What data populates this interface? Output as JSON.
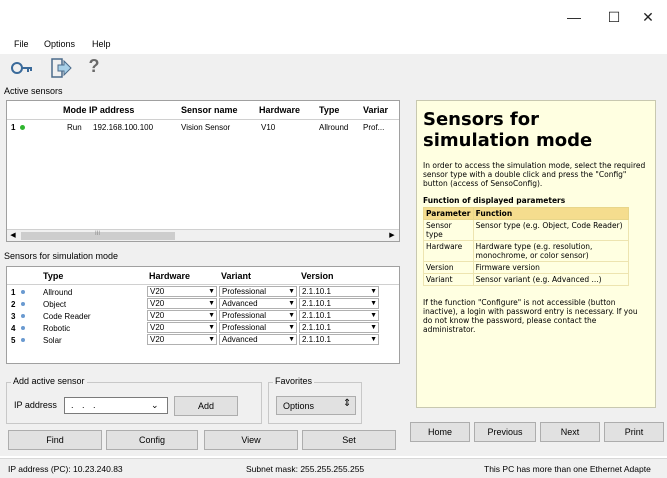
{
  "window": {
    "minimize": "—",
    "maximize": "☐",
    "close": "✕"
  },
  "menu": [
    "File",
    "Options",
    "Help"
  ],
  "toolbar": {
    "icons": [
      "key-icon",
      "export-icon",
      "help-icon"
    ],
    "help_glyph": "?"
  },
  "active_sensors": {
    "label": "Active sensors",
    "headers": [
      "Mode",
      "IP address",
      "Sensor name",
      "Hardware",
      "Type",
      "Variar"
    ],
    "rows": [
      {
        "num": "1",
        "status": "green",
        "mode": "Run",
        "ip": "192.168.100.100",
        "name": "Vision Sensor",
        "hardware": "V10",
        "type": "Allround",
        "variant": "Prof..."
      }
    ],
    "scroll_mark": "III"
  },
  "sim_sensors": {
    "label": "Sensors for simulation mode",
    "headers": [
      "Type",
      "Hardware",
      "Variant",
      "Version"
    ],
    "rows": [
      {
        "num": "1",
        "type": "Allround",
        "hardware": "V20",
        "variant": "Professional",
        "version": "2.1.10.1"
      },
      {
        "num": "2",
        "type": "Object",
        "hardware": "V20",
        "variant": "Advanced",
        "version": "2.1.10.1"
      },
      {
        "num": "3",
        "type": "Code Reader",
        "hardware": "V20",
        "variant": "Professional",
        "version": "2.1.10.1"
      },
      {
        "num": "4",
        "type": "Robotic",
        "hardware": "V20",
        "variant": "Professional",
        "version": "2.1.10.1"
      },
      {
        "num": "5",
        "type": "Solar",
        "hardware": "V20",
        "variant": "Advanced",
        "version": "2.1.10.1"
      }
    ]
  },
  "add_sensor": {
    "title": "Add active sensor",
    "ip_label": "IP address",
    "ip_value": ". . .",
    "add_button": "Add"
  },
  "favorites": {
    "title": "Favorites",
    "value": "Options"
  },
  "buttons": {
    "find": "Find",
    "config": "Config",
    "view": "View",
    "set": "Set"
  },
  "help": {
    "title": "Sensors for simulation mode",
    "intro": "In order to access the simulation mode, select the required sensor type with a double click and press the \"Config\" button (access of SensoConfig).",
    "subhead": "Function of displayed parameters",
    "table_headers": [
      "Parameter",
      "Function"
    ],
    "table_rows": [
      [
        "Sensor type",
        "Sensor type (e.g. Object, Code Reader)"
      ],
      [
        "Hardware",
        "Hardware type (e.g. resolution, monochrome, or color sensor)"
      ],
      [
        "Version",
        "Firmware version"
      ],
      [
        "Variant",
        "Sensor variant (e.g. Advanced ...)"
      ]
    ],
    "footer": "If the function \"Configure\" is not accessible (button inactive), a login with password entry is necessary. If you do not know the password, please contact the administrator."
  },
  "nav": {
    "home": "Home",
    "previous": "Previous",
    "next": "Next",
    "print": "Print"
  },
  "status": {
    "ip": "IP address (PC):  10.23.240.83",
    "subnet": "Subnet mask:  255.255.255.255",
    "message": "This PC has more than one Ethernet Adapte"
  }
}
